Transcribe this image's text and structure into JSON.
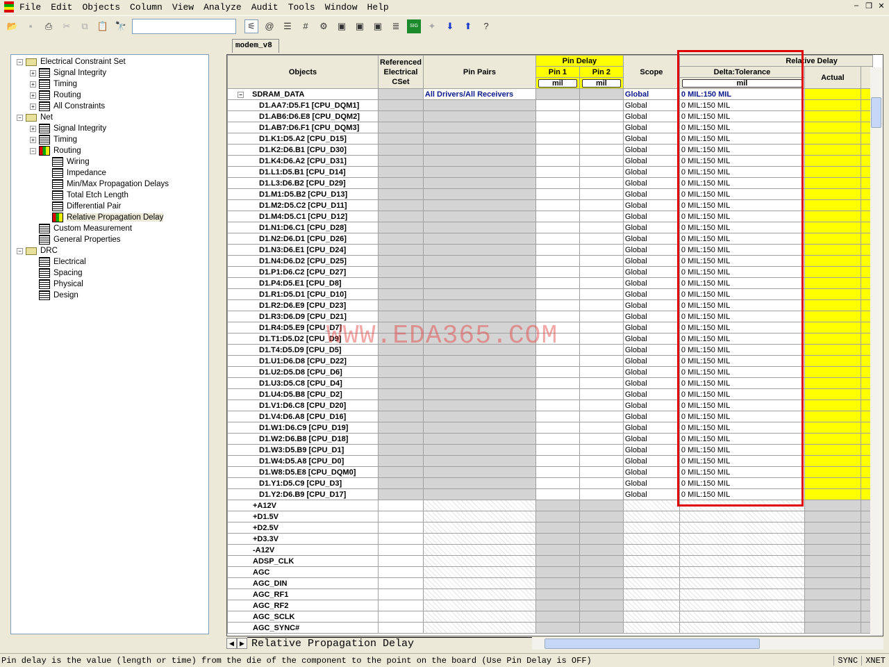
{
  "menu": [
    "File",
    "Edit",
    "Objects",
    "Column",
    "View",
    "Analyze",
    "Audit",
    "Tools",
    "Window",
    "Help"
  ],
  "document_tab": "modem_v8",
  "tree": [
    {
      "label": "Electrical Constraint Set",
      "level": 0,
      "exp": "-",
      "icon": "folder"
    },
    {
      "label": "Signal Integrity",
      "level": 1,
      "exp": "+",
      "icon": "grid"
    },
    {
      "label": "Timing",
      "level": 1,
      "exp": "+",
      "icon": "grid"
    },
    {
      "label": "Routing",
      "level": 1,
      "exp": "+",
      "icon": "grid"
    },
    {
      "label": "All Constraints",
      "level": 1,
      "exp": "+",
      "icon": "grid"
    },
    {
      "label": "Net",
      "level": 0,
      "exp": "-",
      "icon": "folder"
    },
    {
      "label": "Signal Integrity",
      "level": 1,
      "exp": "+",
      "icon": "grid"
    },
    {
      "label": "Timing",
      "level": 1,
      "exp": "+",
      "icon": "grid"
    },
    {
      "label": "Routing",
      "level": 1,
      "exp": "-",
      "icon": "color"
    },
    {
      "label": "Wiring",
      "level": 2,
      "exp": "",
      "icon": "small"
    },
    {
      "label": "Impedance",
      "level": 2,
      "exp": "",
      "icon": "small"
    },
    {
      "label": "Min/Max Propagation Delays",
      "level": 2,
      "exp": "",
      "icon": "small"
    },
    {
      "label": "Total Etch Length",
      "level": 2,
      "exp": "",
      "icon": "small"
    },
    {
      "label": "Differential Pair",
      "level": 2,
      "exp": "",
      "icon": "small"
    },
    {
      "label": "Relative Propagation Delay",
      "level": 2,
      "exp": "",
      "icon": "color",
      "selected": true
    },
    {
      "label": "Custom Measurement",
      "level": 1,
      "exp": "",
      "icon": "grid"
    },
    {
      "label": "General Properties",
      "level": 1,
      "exp": "",
      "icon": "grid"
    },
    {
      "label": "DRC",
      "level": 0,
      "exp": "-",
      "icon": "folder"
    },
    {
      "label": "Electrical",
      "level": 1,
      "exp": "",
      "icon": "grid"
    },
    {
      "label": "Spacing",
      "level": 1,
      "exp": "",
      "icon": "grid"
    },
    {
      "label": "Physical",
      "level": 1,
      "exp": "",
      "icon": "grid"
    },
    {
      "label": "Design",
      "level": 1,
      "exp": "",
      "icon": "grid"
    }
  ],
  "headers": {
    "objects": "Objects",
    "ref_cset": "Referenced Electrical CSet",
    "pin_pairs": "Pin Pairs",
    "pin_delay": "Pin Delay",
    "pin1": "Pin 1",
    "pin2": "Pin 2",
    "unit": "mil",
    "scope": "Scope",
    "relative_delay": "Relative Delay",
    "delta_tol": "Delta:Tolerance",
    "actual": "Actual"
  },
  "group": {
    "toggle": "−",
    "name": "SDRAM_DATA",
    "pin_pairs": "All Drivers/All Receivers",
    "scope": "Global",
    "delta": "0 MIL:150 MIL"
  },
  "member_scope": "Global",
  "member_delta": "0 MIL:150 MIL",
  "members": [
    "D1.AA7:D5.F1 [CPU_DQM1]",
    "D1.AB6:D6.E8 [CPU_DQM2]",
    "D1.AB7:D6.F1 [CPU_DQM3]",
    "D1.K1:D5.A2 [CPU_D15]",
    "D1.K2:D6.B1 [CPU_D30]",
    "D1.K4:D6.A2 [CPU_D31]",
    "D1.L1:D5.B1 [CPU_D14]",
    "D1.L3:D6.B2 [CPU_D29]",
    "D1.M1:D5.B2 [CPU_D13]",
    "D1.M2:D5.C2 [CPU_D11]",
    "D1.M4:D5.C1 [CPU_D12]",
    "D1.N1:D6.C1 [CPU_D28]",
    "D1.N2:D6.D1 [CPU_D26]",
    "D1.N3:D6.E1 [CPU_D24]",
    "D1.N4:D6.D2 [CPU_D25]",
    "D1.P1:D6.C2 [CPU_D27]",
    "D1.P4:D5.E1 [CPU_D8]",
    "D1.R1:D5.D1 [CPU_D10]",
    "D1.R2:D6.E9 [CPU_D23]",
    "D1.R3:D6.D9 [CPU_D21]",
    "D1.R4:D5.E9 [CPU_D7]",
    "D1.T1:D5.D2 [CPU_D9]",
    "D1.T4:D5.D9 [CPU_D5]",
    "D1.U1:D6.D8 [CPU_D22]",
    "D1.U2:D5.D8 [CPU_D6]",
    "D1.U3:D5.C8 [CPU_D4]",
    "D1.U4:D5.B8 [CPU_D2]",
    "D1.V1:D6.C8 [CPU_D20]",
    "D1.V4:D6.A8 [CPU_D16]",
    "D1.W1:D6.C9 [CPU_D19]",
    "D1.W2:D6.B8 [CPU_D18]",
    "D1.W3:D5.B9 [CPU_D1]",
    "D1.W4:D5.A8 [CPU_D0]",
    "D1.W8:D5.E8 [CPU_DQM0]",
    "D1.Y1:D5.C9 [CPU_D3]",
    "D1.Y2:D6.B9 [CPU_D17]"
  ],
  "nets": [
    "+A12V",
    "+D1.5V",
    "+D2.5V",
    "+D3.3V",
    "-A12V",
    "ADSP_CLK",
    "AGC",
    "AGC_DIN",
    "AGC_RF1",
    "AGC_RF2",
    "AGC_SCLK",
    "AGC_SYNC#"
  ],
  "sheet_tab": "Relative Propagation Delay",
  "watermark": "WWW.EDA365.COM",
  "status": {
    "message": "Pin delay is the value (length or time) from the die of the component to the point on the board (Use Pin Delay is OFF)",
    "sync": "SYNC",
    "xnet": "XNET"
  }
}
